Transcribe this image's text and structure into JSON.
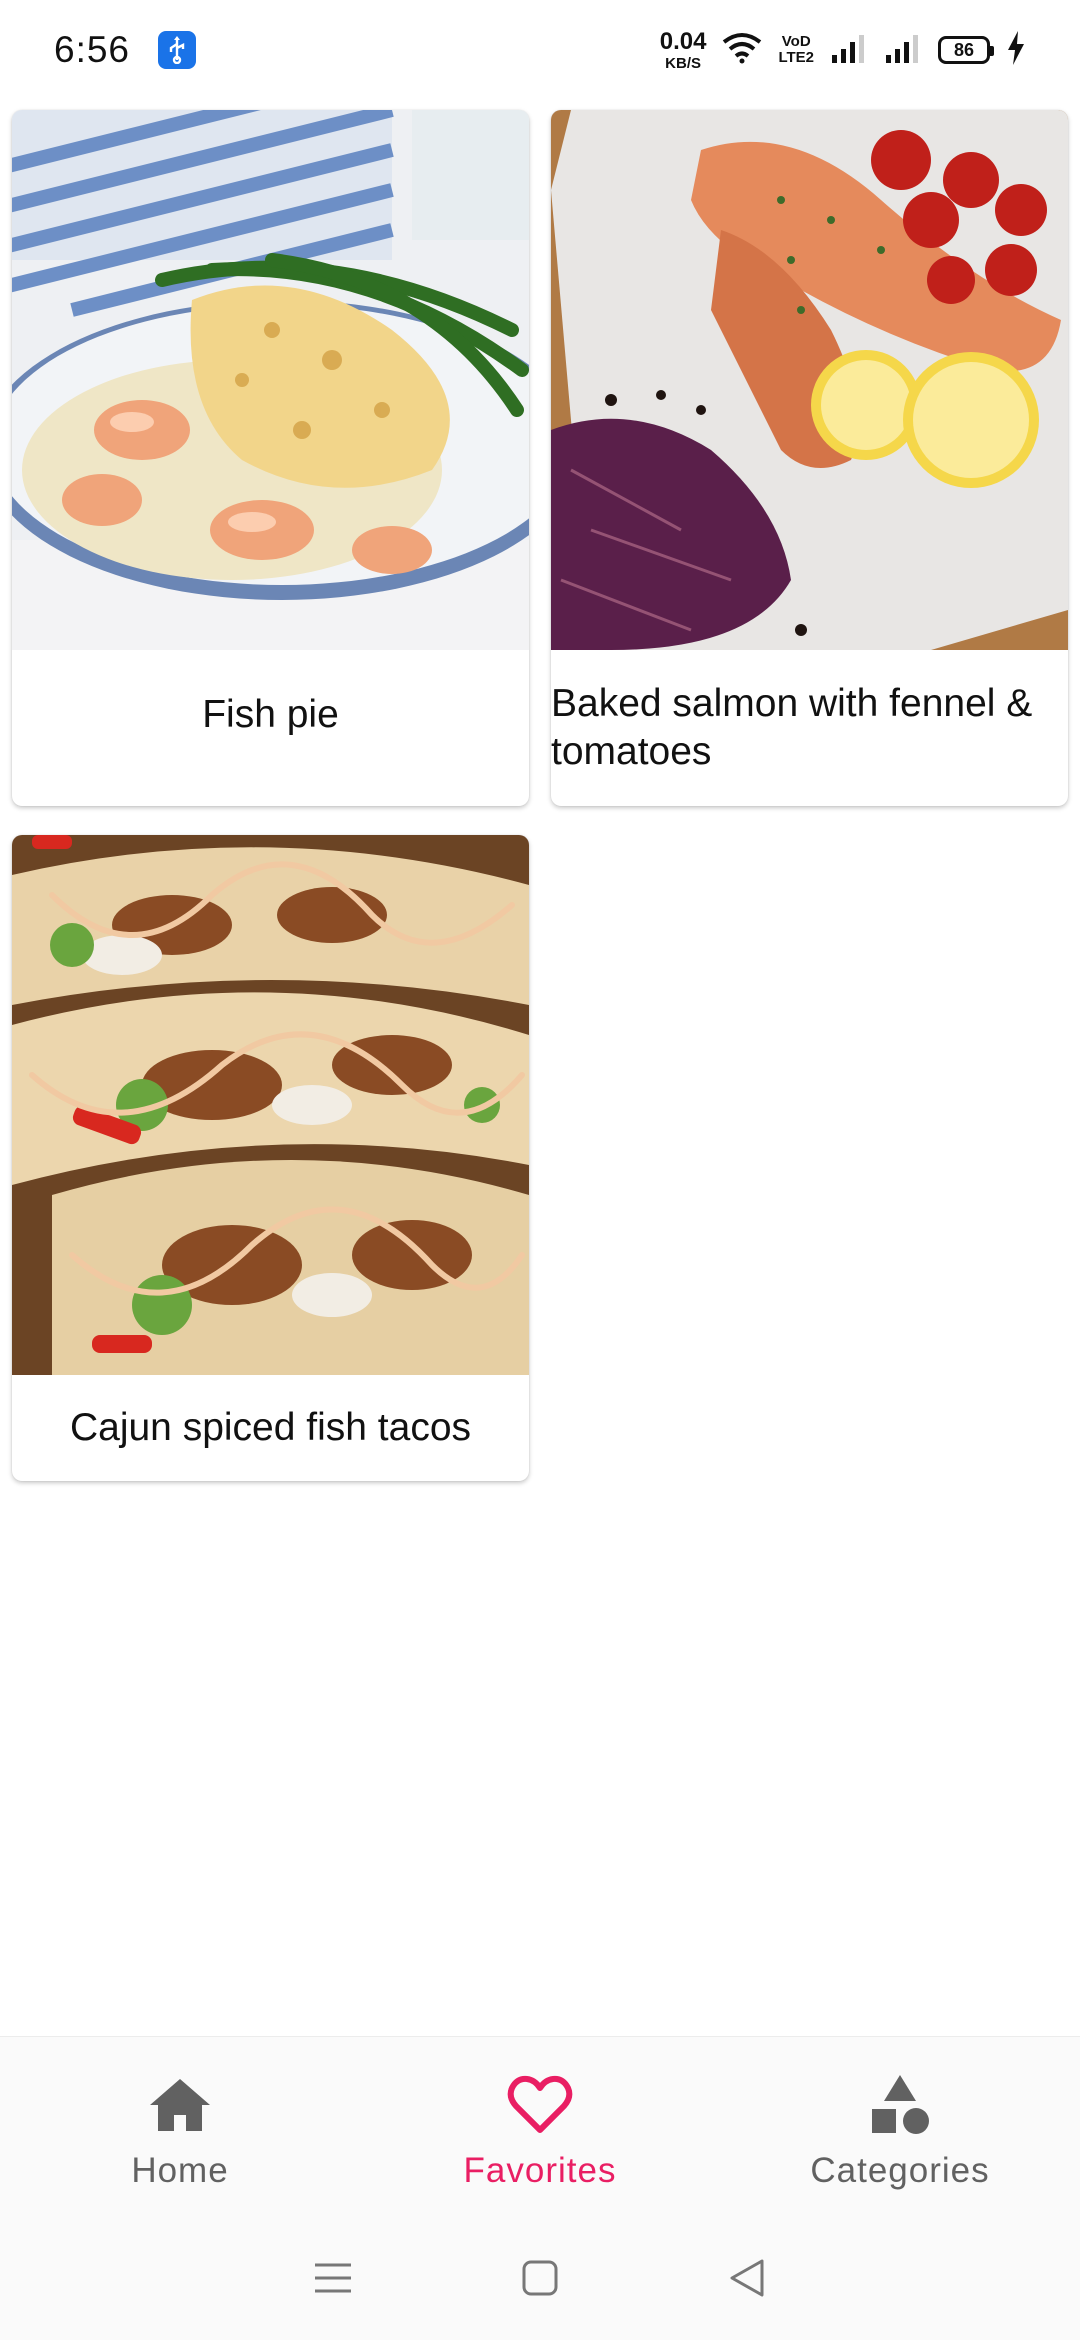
{
  "status_bar": {
    "time": "6:56",
    "net_speed_value": "0.04",
    "net_speed_unit": "KB/S",
    "volte_top": "VoD",
    "volte_bottom": "LTE2",
    "battery_level": "86"
  },
  "recipes": [
    {
      "title": "Fish pie",
      "image_icon": "fish-pie-photo"
    },
    {
      "title": "Baked salmon with fennel & tomatoes",
      "image_icon": "baked-salmon-photo"
    },
    {
      "title": "Cajun spiced fish tacos",
      "image_icon": "fish-tacos-photo"
    }
  ],
  "bottom_nav": {
    "items": [
      {
        "label": "Home",
        "icon": "home-icon",
        "active": false
      },
      {
        "label": "Favorites",
        "icon": "heart-icon",
        "active": true
      },
      {
        "label": "Categories",
        "icon": "categories-icon",
        "active": false
      }
    ]
  },
  "colors": {
    "accent": "#e91e63",
    "nav_inactive": "#616161",
    "usb_badge": "#1a73e8"
  }
}
